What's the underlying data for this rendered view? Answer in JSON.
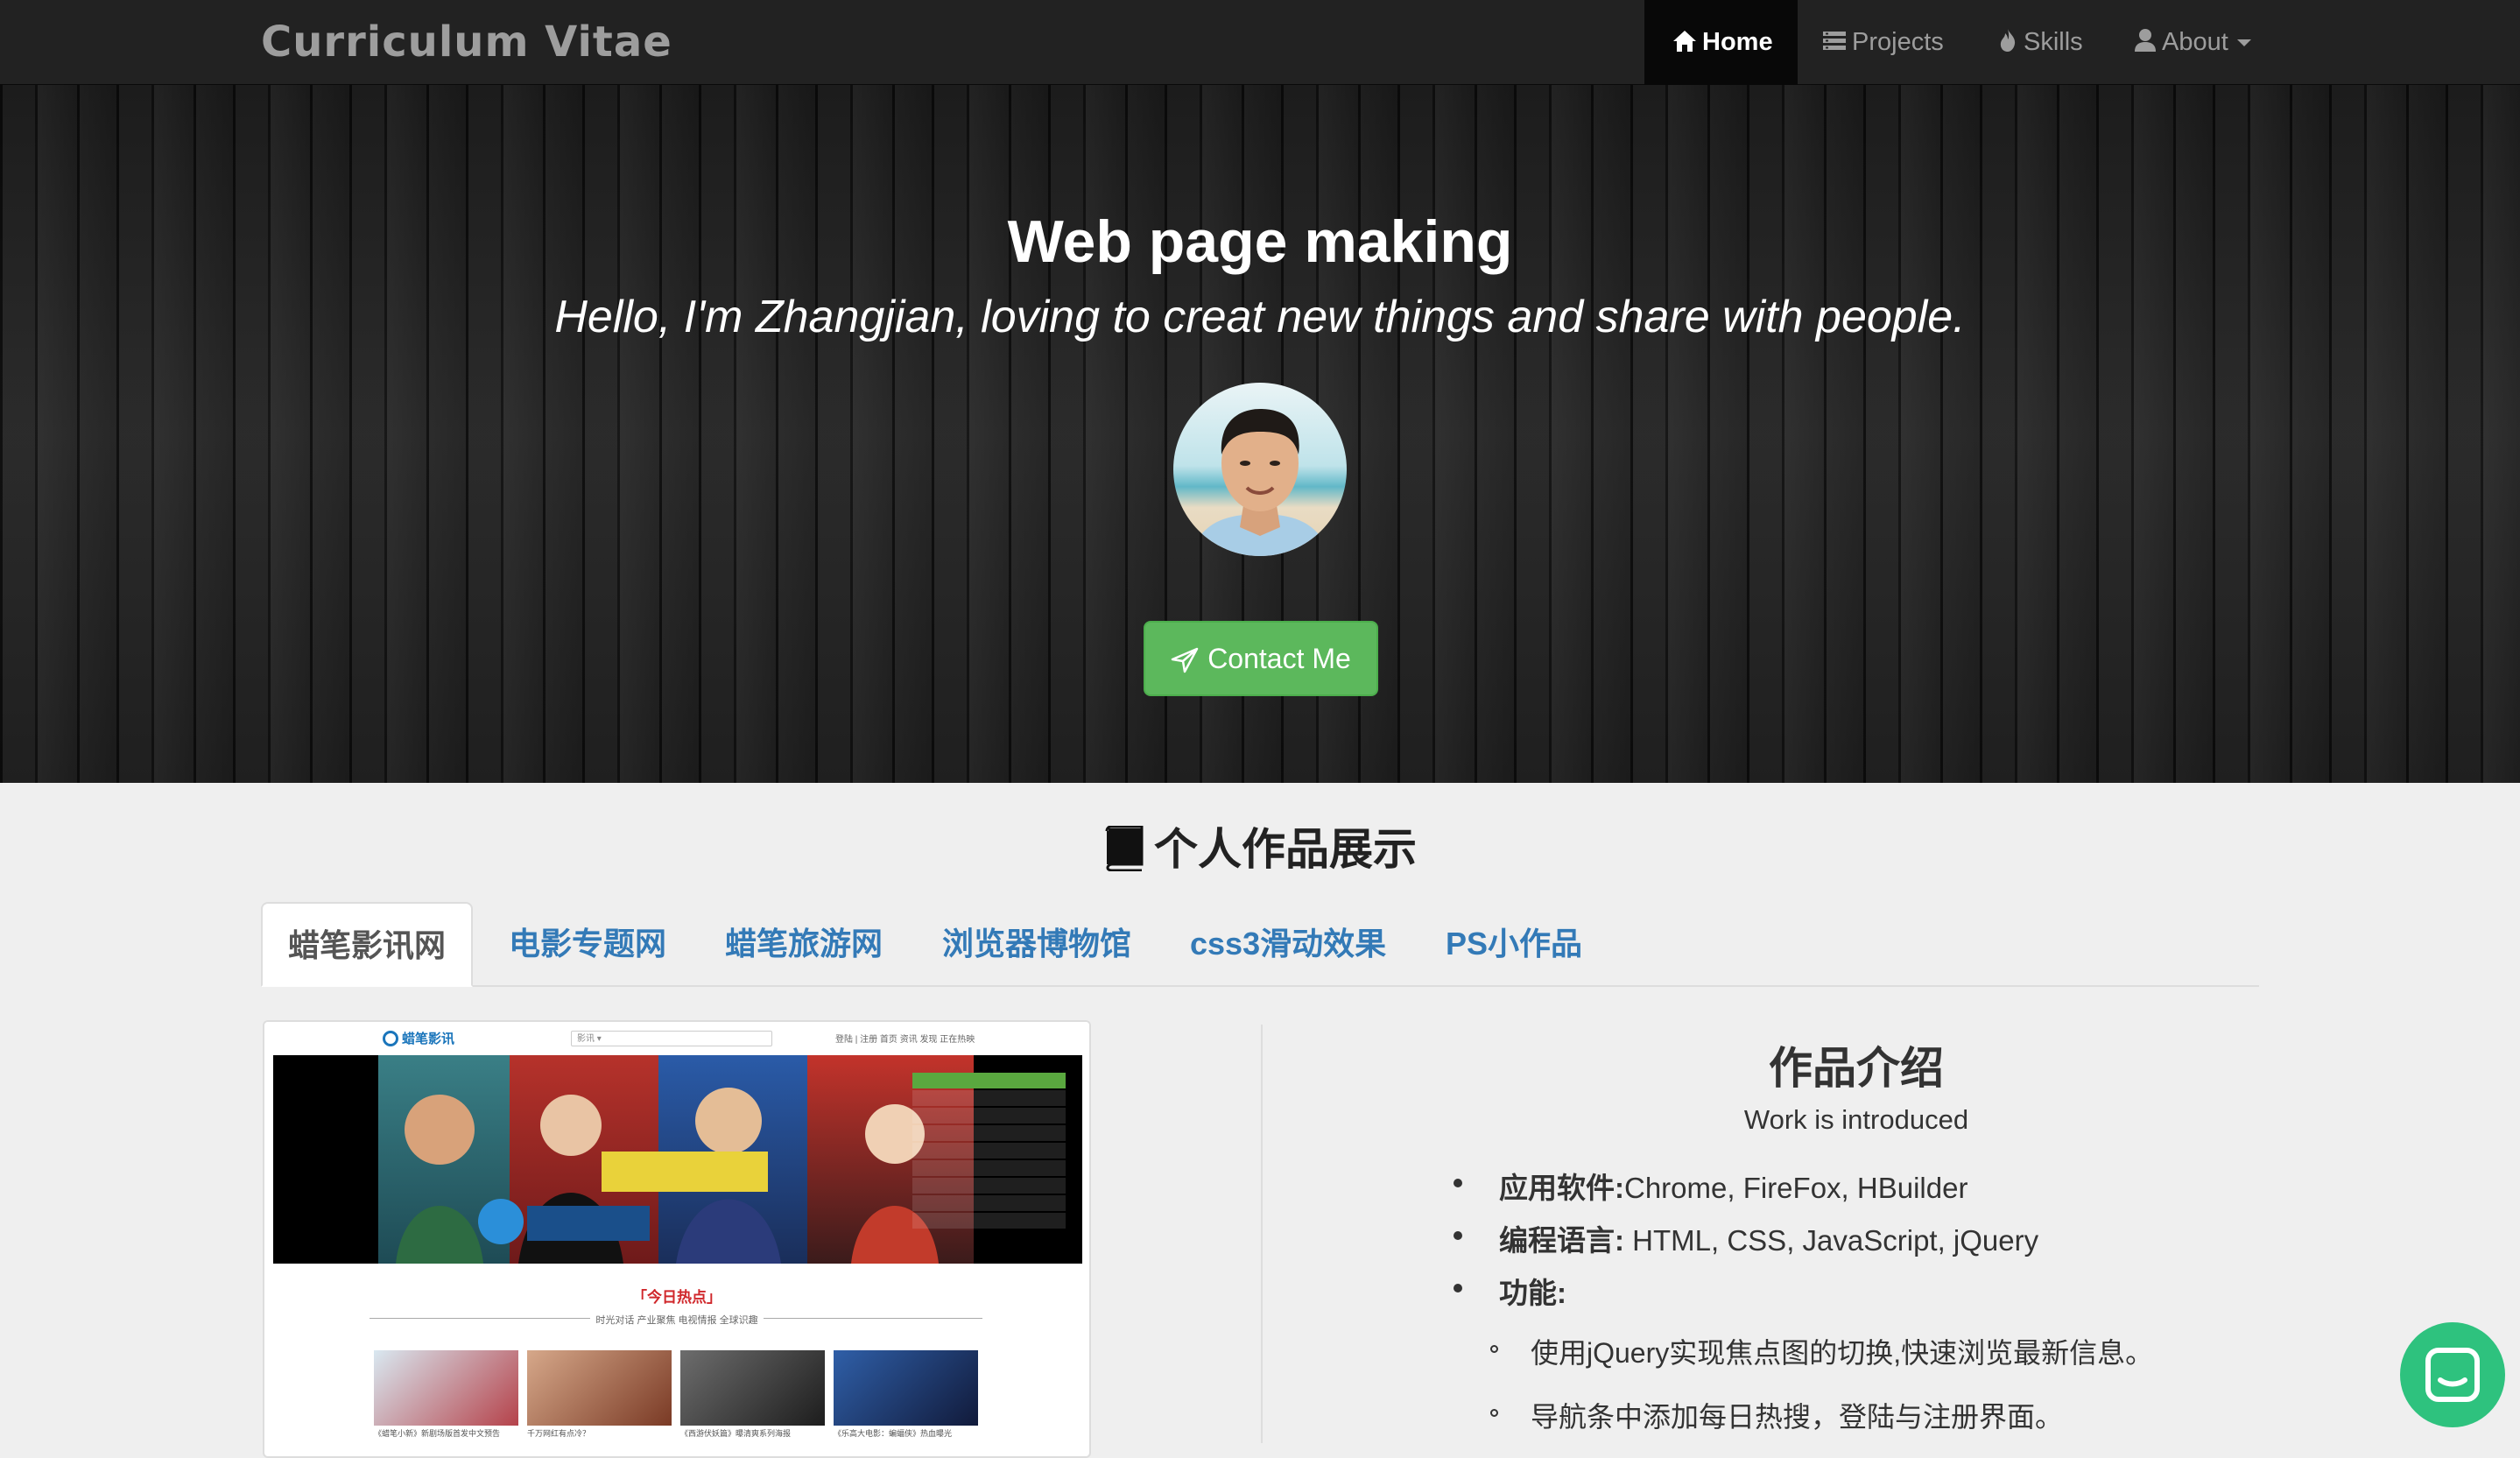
{
  "navbar": {
    "brand": "Curriculum Vitae",
    "items": [
      {
        "label": "Home",
        "icon": "home-icon",
        "active": true
      },
      {
        "label": "Projects",
        "icon": "list-icon"
      },
      {
        "label": "Skills",
        "icon": "fire-icon"
      },
      {
        "label": "About",
        "icon": "user-icon",
        "dropdown": true
      }
    ]
  },
  "hero": {
    "title": "Web page making",
    "subtitle": "Hello, I'm Zhangjian, loving to creat new things and share with people.",
    "button": "Contact Me",
    "button_icon": "send-icon",
    "button_color": "#5cb85c"
  },
  "works": {
    "title": "个人作品展示",
    "title_icon": "book-icon",
    "tabs": [
      "蜡笔影讯网",
      "电影专题网",
      "蜡笔旅游网",
      "浏览器博物馆",
      "css3滑动效果",
      "PS小作品"
    ],
    "active_tab": 0
  },
  "preview": {
    "logo": "蜡笔影讯",
    "search": "影讯 ▾",
    "links": "登陆 | 注册     首页   资讯   发现   正在热映",
    "hot_title": "「今日热点」",
    "categories": "时光对话   产业聚焦   电视情报   全球识趣",
    "captions": [
      "《蜡笔小新》新剧场版首发中文预告",
      "千万网红有点冷？",
      "《西游伏妖篇》曝清爽系列海报",
      "《乐高大电影：蝙蝠侠》热血曝光"
    ]
  },
  "intro": {
    "title": "作品介绍",
    "subtitle": "Work is introduced",
    "items": [
      {
        "label": "应用软件:",
        "value": "Chrome, FireFox, HBuilder"
      },
      {
        "label": "编程语言:",
        "value": " HTML, CSS, JavaScript, jQuery"
      },
      {
        "label": "功能:",
        "value": ""
      }
    ],
    "sub_items": [
      "使用jQuery实现焦点图的切换,快速浏览最新信息。",
      "导航条中添加每日热搜，登陆与注册界面。"
    ]
  },
  "chat": {
    "icon": "chat-icon",
    "color": "#2ec27e"
  }
}
